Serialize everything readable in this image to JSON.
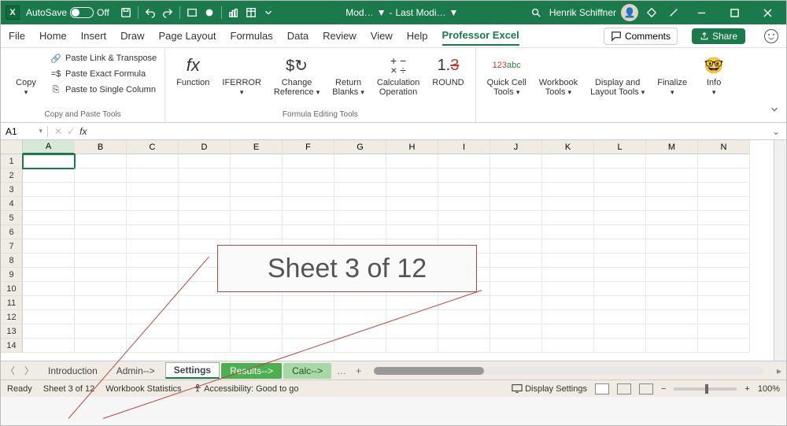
{
  "titlebar": {
    "autosave_label": "AutoSave",
    "autosave_state": "Off",
    "doc_title_left": "Mod…",
    "doc_title_sep": "-",
    "doc_title_right": "Last Modi…",
    "user_name": "Henrik Schiffner"
  },
  "menu": {
    "tabs": [
      "File",
      "Home",
      "Insert",
      "Draw",
      "Page Layout",
      "Formulas",
      "Data",
      "Review",
      "View",
      "Help",
      "Professor Excel"
    ],
    "active_index": 10,
    "comments_label": "Comments",
    "share_label": "Share"
  },
  "ribbon": {
    "group1_label": "Copy and Paste Tools",
    "copy_label": "Copy",
    "paste_link_transpose": "Paste Link & Transpose",
    "paste_exact": "Paste Exact Formula",
    "paste_single_col": "Paste to Single Column",
    "group2_label": "Formula Editing Tools",
    "function_label": "Function",
    "iferror_label": "IFERROR",
    "change_ref_label": "Change\nReference",
    "return_blanks_label": "Return\nBlanks",
    "calc_op_label": "Calculation\nOperation",
    "round_label": "ROUND",
    "quick_cell_label": "Quick Cell\nTools",
    "workbook_tools_label": "Workbook\nTools",
    "display_layout_label": "Display and\nLayout Tools",
    "finalize_label": "Finalize",
    "info_label": "Info"
  },
  "formula_bar": {
    "name_box": "A1",
    "fx": "fx",
    "formula": ""
  },
  "grid": {
    "columns": [
      "A",
      "B",
      "C",
      "D",
      "E",
      "F",
      "G",
      "H",
      "I",
      "J",
      "K",
      "L",
      "M",
      "N"
    ],
    "rows": [
      1,
      2,
      3,
      4,
      5,
      6,
      7,
      8,
      9,
      10,
      11,
      12,
      13,
      14
    ],
    "selected_col_index": 0,
    "selected_row_index": 0
  },
  "sheets": {
    "tabs": [
      {
        "label": "Introduction",
        "style": "plain"
      },
      {
        "label": "Admin-->",
        "style": "plain"
      },
      {
        "label": "Settings",
        "style": "active"
      },
      {
        "label": "Results-->",
        "style": "green"
      },
      {
        "label": "Calc-->",
        "style": "lgreen"
      }
    ],
    "more": "…",
    "add": "+"
  },
  "status": {
    "ready": "Ready",
    "sheet_counter": "Sheet 3 of 12",
    "wb_stats": "Workbook Statistics",
    "accessibility": "Accessibility: Good to go",
    "display_settings": "Display Settings",
    "zoom": "100%"
  },
  "callout": {
    "text": "Sheet 3 of 12"
  }
}
